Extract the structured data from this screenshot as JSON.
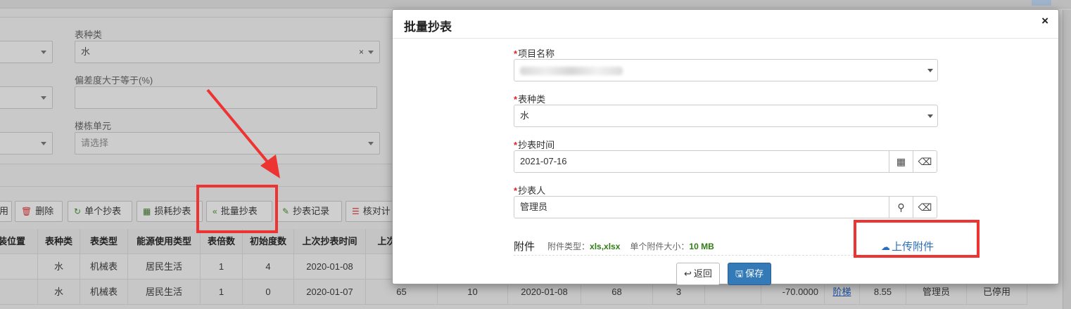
{
  "background": {
    "filters": {
      "meter_type_label": "表种类",
      "meter_type_value": "水",
      "meter_type_clear": "×",
      "deviation_label": "偏差度大于等于(%)",
      "building_label": "楼栋单元",
      "building_placeholder": "请选择"
    },
    "toolbar": {
      "partial_left": "用",
      "delete": "删除",
      "single_read": "单个抄表",
      "loss_read": "损耗抄表",
      "batch_read": "批量抄表",
      "read_records": "抄表记录",
      "check": "核对计"
    },
    "table": {
      "headers": [
        "装位置",
        "表种类",
        "表类型",
        "能源使用类型",
        "表倍数",
        "初始度数",
        "上次抄表时间",
        "上次"
      ],
      "rows": [
        {
          "meter_kind": "水",
          "meter_type": "机械表",
          "energy": "居民生活",
          "multiple": "1",
          "initial": "4",
          "last_time": "2020-01-08"
        },
        {
          "meter_kind": "水",
          "meter_type": "机械表",
          "energy": "居民生活",
          "multiple": "1",
          "initial": "0",
          "last_time": "2020-01-07",
          "extra": [
            "65",
            "10",
            "2020-01-08",
            "68",
            "3",
            "-70.0000",
            "阶梯",
            "8.55",
            "管理员",
            "已停用"
          ]
        }
      ]
    }
  },
  "modal": {
    "title": "批量抄表",
    "close": "×",
    "required_mark": "*",
    "project_label": "项目名称",
    "meter_type_label": "表种类",
    "meter_type_value": "水",
    "read_time_label": "抄表时间",
    "read_time_value": "2021-07-16",
    "reader_label": "抄表人",
    "reader_value": "管理员",
    "attachment": {
      "title": "附件",
      "type_label": "附件类型：",
      "type_value": "xls,xlsx",
      "size_label": "单个附件大小：",
      "size_value": "10 MB",
      "upload_label": "上传附件"
    },
    "back_label": "返回",
    "save_label": "保存"
  },
  "annotation_color": "#ee3333",
  "primary_color": "#337ab7"
}
